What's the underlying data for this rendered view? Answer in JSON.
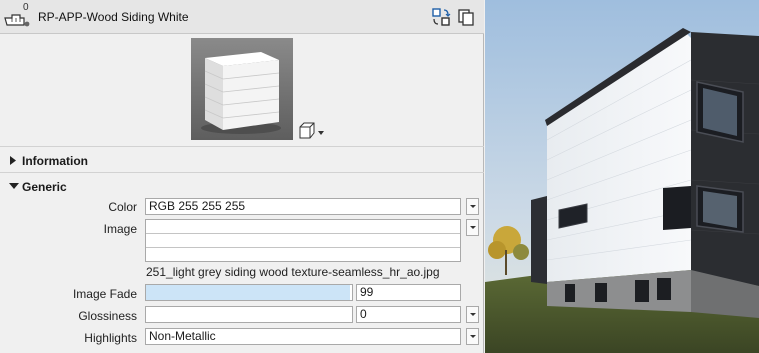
{
  "header": {
    "count": "0",
    "material_name": "RP-APP-Wood Siding White"
  },
  "sections": {
    "information": "Information",
    "generic": "Generic"
  },
  "generic": {
    "color_label": "Color",
    "color_value": "RGB 255 255 255",
    "image_label": "Image",
    "image_file": "251_light grey siding wood texture-seamless_hr_ao.jpg",
    "image_fade_label": "Image Fade",
    "image_fade_value": "99",
    "image_fade_level": 0.99,
    "glossiness_label": "Glossiness",
    "glossiness_value": "0",
    "highlights_label": "Highlights",
    "highlights_value": "Non-Metallic"
  },
  "colors": {
    "panel_bg": "#f0f0f0",
    "slider_fill": "#cce4f7",
    "building_white": "#eef1f5",
    "building_dark": "#2b2d31"
  }
}
